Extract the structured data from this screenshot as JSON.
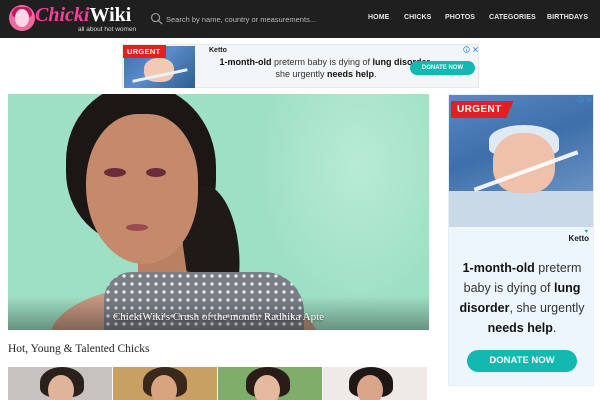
{
  "header": {
    "logo": {
      "word1": "Chicki",
      "word2": "Wiki",
      "tagline": "all about hot women"
    },
    "search": {
      "placeholder": "Search by name, country or measurements..."
    },
    "nav": [
      "HOME",
      "CHICKS",
      "PHOTOS",
      "CATEGORIES",
      "BIRTHDAYS"
    ]
  },
  "ad_top": {
    "badge": "URGENT",
    "brand": "Ketto",
    "message": {
      "p1": "1-month-old",
      "p2": " preterm baby is dying of ",
      "p3": "lung disorder",
      "p4": ", she urgently ",
      "p5": "needs help",
      "p6": "."
    },
    "button": "DONATE NOW",
    "info_icon": "info-icon",
    "close_icon": "close-icon"
  },
  "hero": {
    "caption": "ChickiWiki's Crush of the month: Radhika Apte"
  },
  "section": {
    "title": "Hot, Young & Talented Chicks"
  },
  "ad_right": {
    "badge": "URGENT",
    "brand": "Ketto",
    "message": {
      "p1": "1-month-old",
      "p2": " preterm baby is dying of ",
      "p3": "lung disorder",
      "p4": ", she urgently ",
      "p5": "needs help",
      "p6": "."
    },
    "button": "DONATE NOW",
    "info_icon": "info-icon",
    "close_icon": "close-icon"
  },
  "colors": {
    "header_bg": "#1f1f1f",
    "logo_pink": "#ff3e9a",
    "donate_teal": "#11b9b0",
    "urgent_red": "#e0211f",
    "hero_bg": "#9ee0c4"
  }
}
